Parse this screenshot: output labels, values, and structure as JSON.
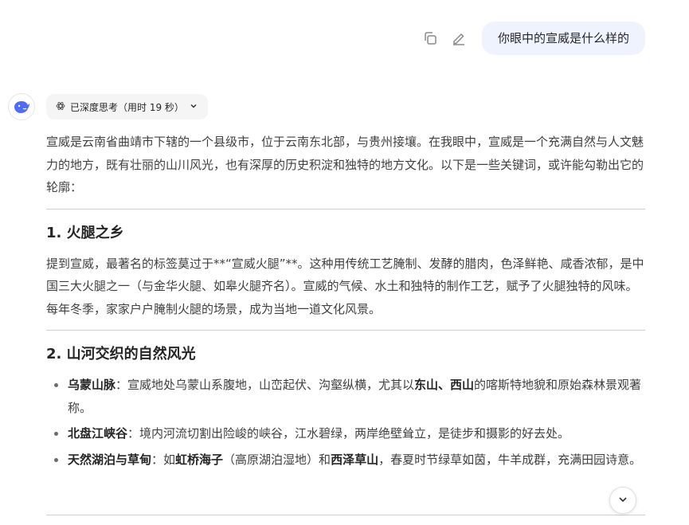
{
  "user_message": {
    "text": "你眼中的宣威是什么样的"
  },
  "icons": {
    "copy": "copy-icon",
    "edit": "pencil-icon",
    "avatar": "whale-logo-icon",
    "think": "atom-icon",
    "chevron": "chevron-down-icon"
  },
  "thinking": {
    "label": "已深度思考（用时 19 秒）"
  },
  "intro": "宣威是云南省曲靖市下辖的一个县级市，位于云南东北部，与贵州接壤。在我眼中，宣威是一个充满自然与人文魅力的地方，既有壮丽的山川风光，也有深厚的历史积淀和独特的地方文化。以下是一些关键词，或许能勾勒出它的轮廓：",
  "section1": {
    "title": "1. 火腿之乡",
    "body": "提到宣威，最著名的标签莫过于**“宣威火腿”**。这种用传统工艺腌制、发酵的腊肉，色泽鲜艳、咸香浓郁，是中国三大火腿之一（与金华火腿、如皋火腿齐名）。宣威的气候、水土和独特的制作工艺，赋予了火腿独特的风味。每年冬季，家家户户腌制火腿的场景，成为当地一道文化风景。"
  },
  "section2": {
    "title": "2. 山河交织的自然风光",
    "items": [
      {
        "strong": "乌蒙山脉",
        "t1": "：宣威地处乌蒙山系腹地，山峦起伏、沟壑纵横，尤其以",
        "s2": "东山、西山",
        "t2": "的喀斯特地貌和原始森林景观著称。"
      },
      {
        "strong": "北盘江峡谷",
        "t1": "：境内河流切割出险峻的峡谷，江水碧绿，两岸绝壁耸立，是徒步和摄影的好去处。"
      },
      {
        "strong": "天然湖泊与草甸",
        "t1": "：如",
        "s2": "虹桥海子",
        "t2": "（高原湖泊湿地）和",
        "s3": "西泽草山",
        "t3": "，春夏时节绿草如茵，牛羊成群，充满田园诗意。"
      }
    ]
  },
  "colors": {
    "bubble": "#eef3fd",
    "accent": "#4d6bfe",
    "text": "#404040"
  }
}
